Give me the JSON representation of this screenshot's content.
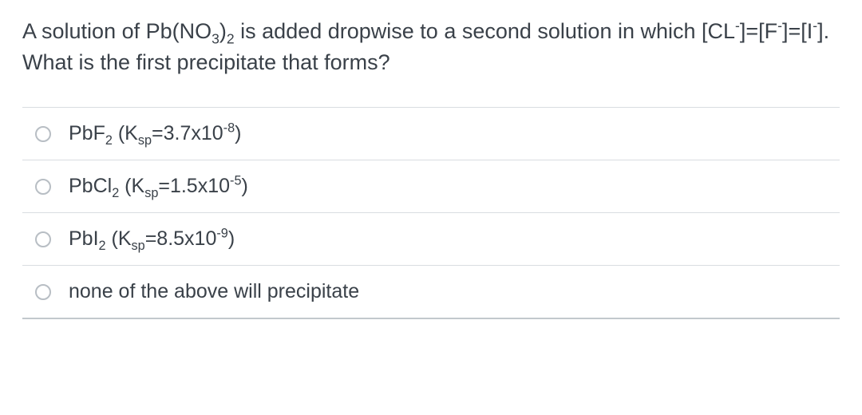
{
  "question": {
    "t1": "A solution of Pb(NO",
    "sub1": "3",
    "t2": ")",
    "sub2": "2",
    "t3": " is added dropwise to a second solution in which [CL",
    "sup1": "-",
    "t4": "]=[F",
    "sup2": "-",
    "t5": "]=[I",
    "sup3": "-",
    "t6": "]. What is the first precipitate that forms?"
  },
  "options": [
    {
      "a": "PbF",
      "sub1": "2",
      "b": " (K",
      "sub2": "sp",
      "c": "=3.7x10",
      "sup1": "-8",
      "d": ")"
    },
    {
      "a": "PbCl",
      "sub1": "2",
      "b": " (K",
      "sub2": "sp",
      "c": "=1.5x10",
      "sup1": "-5",
      "d": ")"
    },
    {
      "a": "PbI",
      "sub1": "2",
      "b": " (K",
      "sub2": "sp",
      "c": "=8.5x10",
      "sup1": "-9",
      "d": ")"
    },
    {
      "a": "none of the above will precipitate",
      "sub1": "",
      "b": "",
      "sub2": "",
      "c": "",
      "sup1": "",
      "d": ""
    }
  ]
}
